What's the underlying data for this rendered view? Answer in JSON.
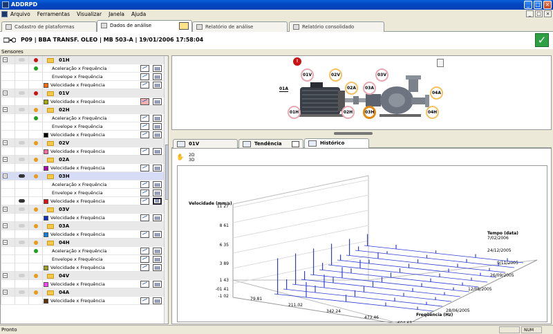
{
  "window": {
    "title": "ADDRPD",
    "min": "_",
    "max": "□",
    "close": "×"
  },
  "menu": [
    "Arquivo",
    "Ferramentas",
    "Visualizar",
    "Janela",
    "Ajuda"
  ],
  "tabs": [
    {
      "label": "Cadastro de plataformas"
    },
    {
      "label": "Dados de análise"
    },
    {
      "label": "Relatório de análise"
    },
    {
      "label": "Relatório consolidado"
    }
  ],
  "header": {
    "title": "P09 | BBA TRANSF. OLEO | MB 503-A | 19/01/2006 17:58:04",
    "ok": "✓"
  },
  "sensors_label": "Sensores",
  "colors": {
    "green": "#22a022",
    "red": "#c81414",
    "orange": "#e89a1a"
  },
  "tree": [
    {
      "type": "group",
      "dot": "red",
      "name": "01H"
    },
    {
      "type": "child",
      "dot": "green",
      "name": "Aceleração x Frequência"
    },
    {
      "type": "child",
      "name": "Envelope x Frequência"
    },
    {
      "type": "child",
      "sq": "#ff6a00",
      "name": "Velocidade x Frequência"
    },
    {
      "type": "group",
      "dot": "red",
      "name": "01V",
      "hl": true
    },
    {
      "type": "child",
      "sq": "#a8a800",
      "name": "Velocidade x Frequência",
      "red": true
    },
    {
      "type": "group",
      "dot": "orange",
      "name": "02H"
    },
    {
      "type": "child",
      "dot": "green",
      "name": "Aceleração x Frequência"
    },
    {
      "type": "child",
      "name": "Envelope x Frequência"
    },
    {
      "type": "child",
      "sq": "#000000",
      "name": "Velocidade x Frequência"
    },
    {
      "type": "group",
      "dot": "orange",
      "name": "02V"
    },
    {
      "type": "child",
      "sq": "#ff6aa0",
      "name": "Velocidade x Frequência"
    },
    {
      "type": "group",
      "dot": "orange",
      "name": "02A"
    },
    {
      "type": "child",
      "sq": "#b000b0",
      "name": "Velocidade x Frequência"
    },
    {
      "type": "group",
      "dot": "orange",
      "name": "03H",
      "sel": true,
      "dark": true
    },
    {
      "type": "child",
      "name": "Aceleração x Frequência"
    },
    {
      "type": "child",
      "name": "Envelope x Frequência"
    },
    {
      "type": "child",
      "sq": "#e01010",
      "name": "Velocidade x Frequência",
      "dark": true,
      "selb": true
    },
    {
      "type": "group",
      "dot": "orange",
      "name": "03V"
    },
    {
      "type": "child",
      "sq": "#1030c0",
      "name": "Velocidade x Frequência"
    },
    {
      "type": "group",
      "dot": "orange",
      "name": "03A"
    },
    {
      "type": "child",
      "sq": "#1080e0",
      "name": "Velocidade x Frequência"
    },
    {
      "type": "group",
      "dot": "orange",
      "name": "04H"
    },
    {
      "type": "child",
      "dot": "green",
      "name": "Aceleração x Frequência"
    },
    {
      "type": "child",
      "name": "Envelope x Frequência"
    },
    {
      "type": "child",
      "sq": "#a0a020",
      "name": "Velocidade x Frequência"
    },
    {
      "type": "group",
      "dot": "orange",
      "name": "04V"
    },
    {
      "type": "child",
      "sq": "#ff40ff",
      "name": "Velocidade x Frequência"
    },
    {
      "type": "group",
      "dot": "orange",
      "name": "04A"
    },
    {
      "type": "child",
      "sq": "#603000",
      "name": "Velocidade x Frequência"
    }
  ],
  "diagram": {
    "alert": "!",
    "points": [
      "01V",
      "02V",
      "03V",
      "01A",
      "02A",
      "03A",
      "04A",
      "01H",
      "02H",
      "03H",
      "04H"
    ]
  },
  "lower_tabs": [
    "01V",
    "Tendência",
    "Histórico"
  ],
  "view_toggle": {
    "d2": "2D",
    "d3": "3D"
  },
  "chart_data": {
    "type": "waterfall-3d",
    "ylabel": "Velocidade (mm/s)",
    "yticks": [
      "11 27",
      "8 61",
      "6 35",
      "3 89",
      "1 43",
      "-01 41",
      "-1 02"
    ],
    "xlabel": "Freqüência (Hz)",
    "xticks": [
      "79.81",
      "211.02",
      "342.24",
      "473.46",
      "604.67"
    ],
    "zlabel": "Tempo (data)",
    "zticks": [
      "7/02/2006",
      "24/12/2005",
      "9/11/2005",
      "26/09/2005",
      "12/08/2005",
      "28/06/2005"
    ]
  },
  "status": {
    "text": "Pronto",
    "num": "NUM"
  }
}
